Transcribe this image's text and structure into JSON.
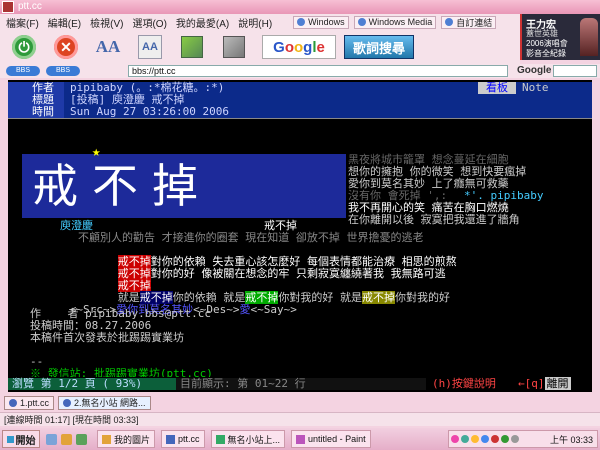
{
  "window": {
    "title": "ptt.cc"
  },
  "menu": {
    "items": [
      "檔案(F)",
      "編輯(E)",
      "檢視(V)",
      "選項(O)",
      "我的最愛(A)",
      "說明(H)"
    ]
  },
  "links": [
    "Windows",
    "Windows Media",
    "自訂連結"
  ],
  "badge": {
    "name": "王力宏",
    "line2": "蓋世英雄",
    "line3": "2006演唱會",
    "line4": "影音全紀錄"
  },
  "toolbar": {
    "font_large_icon": "AA",
    "font_box_icon": "AA",
    "google_label": "Google",
    "lyric_label": "歌詞搜尋"
  },
  "address": {
    "url": "bbs://ptt.cc",
    "search_label": "Google",
    "pill1": "BBS",
    "pill2": "BBS"
  },
  "post": {
    "author_label": "作者",
    "author": "pipibaby (。:*棉花糖。:*)",
    "title_label": "標題",
    "title": "[投稿] 庾澄慶 戒不掉",
    "time_label": "時間",
    "time": "Sun Aug 27 03:26:00 2006",
    "board_label": "看板",
    "board": "Note"
  },
  "banner": {
    "title": "戒不掉",
    "star": "★",
    "artist": "庾澄慶",
    "song": "戒不掉"
  },
  "lyrics_right": [
    "黑夜將城市籠罩 想念蔓延在細胞",
    "想你的擁抱 你的微笑 想到快要瘋掉",
    "愛你到莫名其妙 上了癮無可救藥",
    "沒有你 會死掉 ',:",
    "我不再開心的笑 痛苦在胸口燃燒",
    "在你離開以後 寂寞把我還進了牆角"
  ],
  "signature_user": "*'. pipibaby",
  "lyrics_lower": [
    "不顧別人的勸告 才接進你的圈套 現在知道 卻放不掉 世界擔憂的逃老",
    "戒不掉",
    "對你的依賴 失去重心該怎麼好 每個表情都能治療 相思的煎熬",
    "戒不掉",
    "對你的好 像被關在想念的牢 只剩寂寞纏繞著我 我無路可逃",
    "戒不掉",
    "就是",
    "你的依賴 就是",
    "你對我的好 就是",
    "你對我的好"
  ],
  "music_nav": {
    "src": "<~Src~>",
    "sep_1": "愛你到莫名其妙",
    "des": "<~Des~>",
    "say": "<~Say~>",
    "sep_2": "愛"
  },
  "footer": {
    "author_line": "作    者 pipibaby.bbs@ptt.cc",
    "time_line": "投稿時間：08.27.2006",
    "note_line": "本稿件首次發表於批踢踢實業坊",
    "dash": "--",
    "origin": "※ 發信站: 批踢踢實業坊(ptt.cc)"
  },
  "statusline": {
    "browse": "瀏覽 第 1/2 頁 ( 93%)",
    "show": "目前顯示: 第 01~22 行",
    "help": "(h)按鍵說明",
    "leave_prefix": "←[q]",
    "leave": "離開"
  },
  "tabs": [
    {
      "label": "1.ptt.cc",
      "active": false
    },
    {
      "label": "2.無名小站 網路...",
      "active": true
    }
  ],
  "statusbar": "[連線時間 01:17] [現在時間 03:33]",
  "taskbar": {
    "start_label": "開始",
    "tasks": [
      "我的圖片",
      "ptt.cc",
      "無名小站上...",
      "untitled - Paint"
    ],
    "clock": "上午 03:33"
  },
  "colors": {
    "terminal_bg": "#000000",
    "header_bg": "#0c2a8a",
    "banner_bg": "#1d2a9a",
    "accent_red": "#cc0000"
  }
}
